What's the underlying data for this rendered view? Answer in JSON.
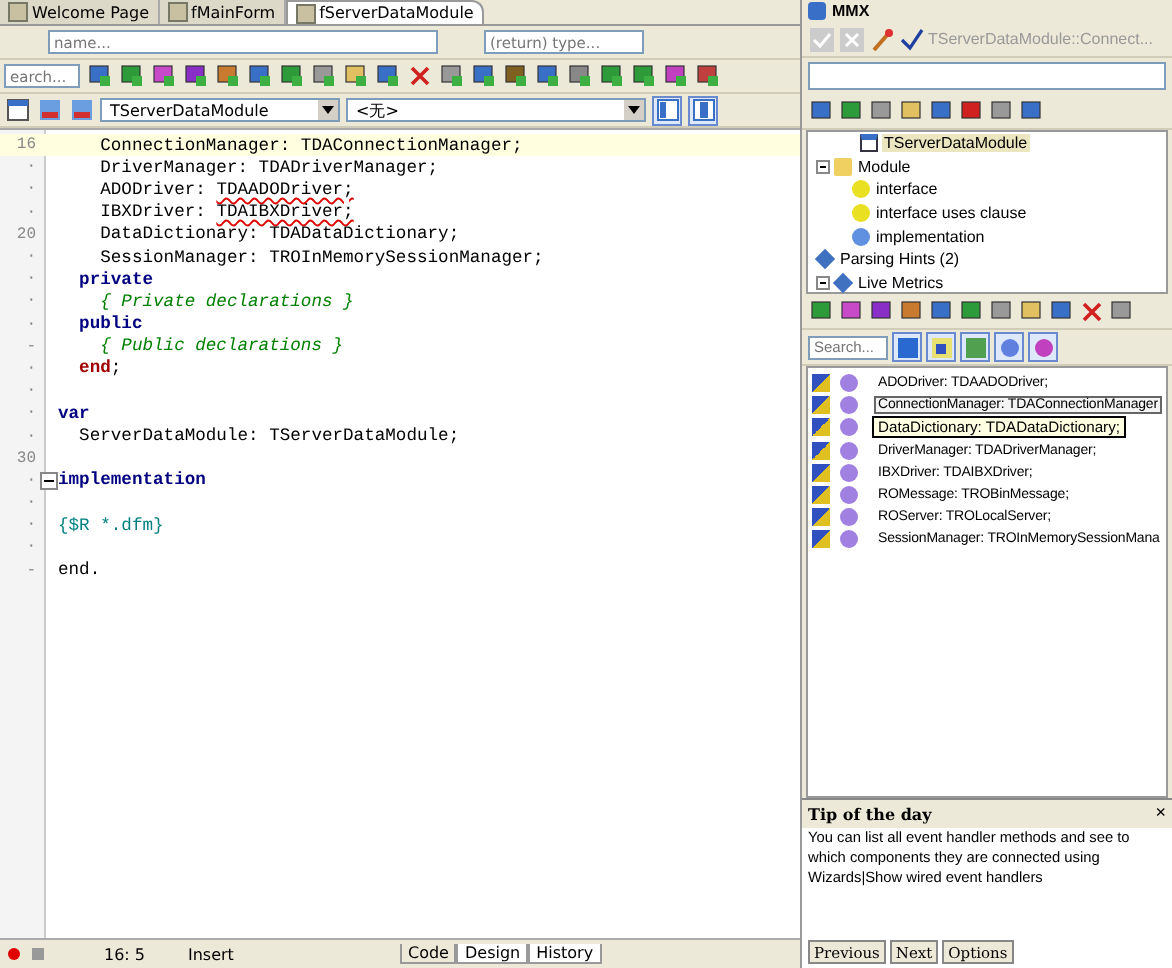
{
  "editor_tabs": [
    {
      "label": "Welcome Page",
      "selected": false
    },
    {
      "label": "fMainForm",
      "selected": false
    },
    {
      "label": "fServerDataModule",
      "selected": true
    }
  ],
  "name_field": {
    "placeholder": "name..."
  },
  "type_field": {
    "placeholder": "(return) type..."
  },
  "search_field": {
    "placeholder": "earch..."
  },
  "class_combo": {
    "value": "TServerDataModule"
  },
  "method_combo": {
    "value": "<无>"
  },
  "code_lines": [
    {
      "gutter": "16",
      "current": true,
      "parts": [
        {
          "kind": "plain",
          "text": "    ConnectionManager: TDAConnectionManager;"
        }
      ]
    },
    {
      "gutter": "·",
      "current": false,
      "parts": [
        {
          "kind": "plain",
          "text": "    DriverManager: TDADriverManager;"
        }
      ]
    },
    {
      "gutter": "·",
      "current": false,
      "parts": [
        {
          "kind": "plain",
          "text": "    ADODriver: "
        },
        {
          "kind": "error",
          "text": "TDAADODriver;"
        }
      ]
    },
    {
      "gutter": "·",
      "current": false,
      "parts": [
        {
          "kind": "plain",
          "text": "    IBXDriver: "
        },
        {
          "kind": "error",
          "text": "TDAIBXDriver;"
        }
      ]
    },
    {
      "gutter": "20",
      "current": false,
      "parts": [
        {
          "kind": "plain",
          "text": "    DataDictionary: TDADataDictionary;"
        }
      ]
    },
    {
      "gutter": "·",
      "current": false,
      "parts": [
        {
          "kind": "plain",
          "text": "    SessionManager: TROInMemorySessionManager;"
        }
      ]
    },
    {
      "gutter": "·",
      "current": false,
      "parts": [
        {
          "kind": "keyword",
          "text": "  private"
        }
      ]
    },
    {
      "gutter": "·",
      "current": false,
      "parts": [
        {
          "kind": "comment",
          "text": "    { Private declarations }"
        }
      ]
    },
    {
      "gutter": "·",
      "current": false,
      "parts": [
        {
          "kind": "keyword",
          "text": "  public"
        }
      ]
    },
    {
      "gutter": "-",
      "current": false,
      "parts": [
        {
          "kind": "comment",
          "text": "    { Public declarations }"
        }
      ]
    },
    {
      "gutter": "·",
      "current": false,
      "parts": [
        {
          "kind": "end",
          "text": "  end"
        },
        {
          "kind": "plain",
          "text": ";"
        }
      ]
    },
    {
      "gutter": "·",
      "current": false
    },
    {
      "gutter": "·",
      "current": false,
      "parts": [
        {
          "kind": "keyword",
          "text": "var"
        }
      ]
    },
    {
      "gutter": "·",
      "current": false,
      "parts": [
        {
          "kind": "plain",
          "text": "  ServerDataModule: TServerDataModule;"
        }
      ]
    },
    {
      "gutter": "30",
      "current": false
    },
    {
      "gutter": "·",
      "current": false,
      "fold": true,
      "parts": [
        {
          "kind": "keyword",
          "text": "implementation"
        }
      ]
    },
    {
      "gutter": "·",
      "current": false
    },
    {
      "gutter": "·",
      "current": false,
      "parts": [
        {
          "kind": "directive",
          "text": "{$R *.dfm}"
        }
      ]
    },
    {
      "gutter": "·",
      "current": false
    },
    {
      "gutter": "-",
      "current": false,
      "parts": [
        {
          "kind": "plain",
          "text": "end."
        }
      ]
    }
  ],
  "status_bar": {
    "position": "16: 5",
    "mode": "Insert"
  },
  "view_tabs": [
    {
      "label": "Code",
      "selected": true
    },
    {
      "label": "Design",
      "selected": false
    },
    {
      "label": "History",
      "selected": false
    }
  ],
  "mmx": {
    "title": "MMX",
    "context": "TServerDataModule::Connect...",
    "tree": [
      {
        "label": "TServerDataModule",
        "selected": true,
        "kind": "class"
      },
      {
        "label": "Module",
        "selected": false,
        "kind": "folder",
        "expanded": true,
        "children": [
          {
            "label": "interface",
            "selected": false,
            "kind": "plus"
          },
          {
            "label": "interface uses clause",
            "selected": false,
            "kind": "plus"
          },
          {
            "label": "implementation",
            "selected": false,
            "kind": "minus"
          }
        ]
      },
      {
        "label": "Parsing Hints (2)",
        "selected": false,
        "kind": "hint"
      },
      {
        "label": "Live Metrics",
        "selected": false,
        "kind": "hint",
        "expanded": true
      }
    ],
    "search": {
      "placeholder": "Search..."
    },
    "fields": [
      {
        "label": "ADODriver: TDAADODriver;",
        "selected": false
      },
      {
        "label": "ConnectionManager: TDAConnectionManager",
        "selected": true
      },
      {
        "label": "DriverManager: TDADriverManager;",
        "selected": false
      },
      {
        "label": "IBXDriver: TDAIBXDriver;",
        "selected": false
      },
      {
        "label": "ROMessage: TROBinMessage;",
        "selected": false
      },
      {
        "label": "ROServer: TROLocalServer;",
        "selected": false
      },
      {
        "label": "SessionManager: TROInMemorySessionMana",
        "selected": false
      }
    ],
    "tooltip": "DataDictionary: TDADataDictionary;",
    "tip": {
      "title": "Tip of the day",
      "close": "×",
      "text": "You can list all event handler methods and see to which components they are connected using Wizards|Show wired event handlers",
      "buttons": [
        "Previous",
        "Next",
        "Options"
      ]
    }
  }
}
